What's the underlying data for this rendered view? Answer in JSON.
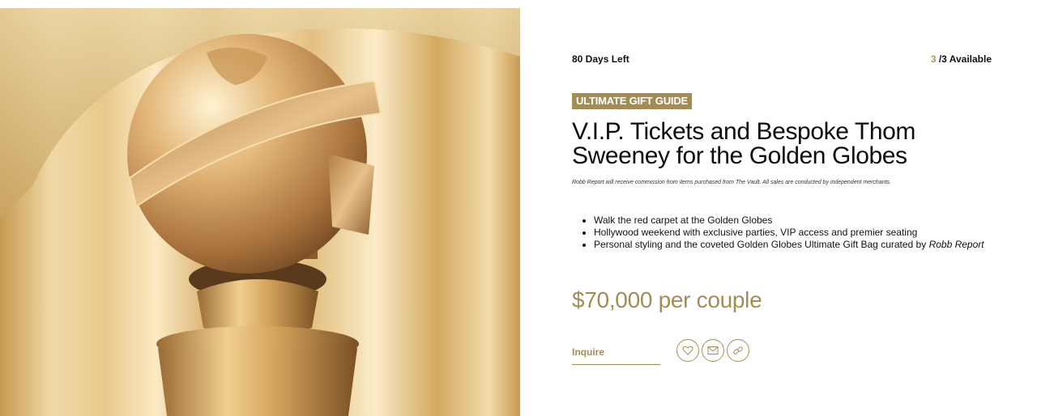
{
  "hero": {
    "image_description": "Golden Globe trophy statue against gold curtains"
  },
  "listing": {
    "days_left": "80 Days Left",
    "available_count": "3",
    "available_suffix": " /3 Available",
    "tag": "ULTIMATE GIFT GUIDE",
    "title": "V.I.P. Tickets and Bespoke Thom Sweeney for the Golden Globes",
    "disclaimer": "Robb Report will receive commission from items purchased from The Vault. All sales are conducted by independent merchants.",
    "bullets": [
      "Walk the red carpet at the Golden Globes",
      "Hollywood weekend with exclusive parties, VIP access and premier seating"
    ],
    "bullet3_text": "Personal styling and the coveted Golden Globes Ultimate Gift Bag curated by ",
    "bullet3_em": "Robb Report",
    "price": "$70,000 per couple",
    "inquire_label": "Inquire"
  },
  "icons": {
    "favorite": "heart-icon",
    "email": "envelope-icon",
    "share": "link-icon"
  },
  "colors": {
    "accent": "#a48d55",
    "text": "#111111"
  }
}
